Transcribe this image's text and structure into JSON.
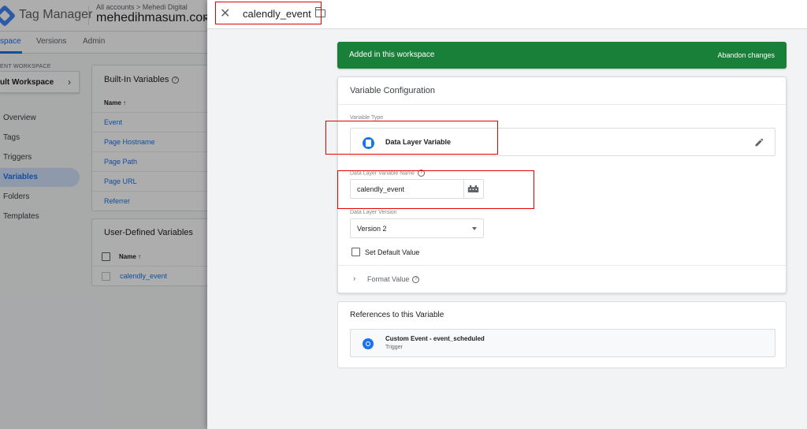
{
  "app": {
    "name": "Tag Manager",
    "breadcrumb": "All accounts > Mehedi Digital",
    "container": "mehedihmasum.com"
  },
  "tabs": [
    {
      "label": "Workspace",
      "visible_text": "space",
      "active": true
    },
    {
      "label": "Versions",
      "active": false
    },
    {
      "label": "Admin",
      "active": false
    }
  ],
  "workspace": {
    "label": "ENT WORKSPACE",
    "name": "ult Workspace"
  },
  "sidebar": {
    "items": [
      {
        "label": "Overview",
        "active": false
      },
      {
        "label": "Tags",
        "active": false
      },
      {
        "label": "Triggers",
        "active": false
      },
      {
        "label": "Variables",
        "active": true
      },
      {
        "label": "Folders",
        "active": false
      },
      {
        "label": "Templates",
        "active": false
      }
    ]
  },
  "builtin": {
    "title": "Built-In Variables",
    "column": "Name ↑",
    "rows": [
      "Event",
      "Page Hostname",
      "Page Path",
      "Page URL",
      "Referrer"
    ]
  },
  "userdefined": {
    "title": "User-Defined Variables",
    "column": "Name ↑",
    "rows": [
      "calendly_event"
    ]
  },
  "panel": {
    "title": "calendly_event",
    "banner": {
      "text": "Added in this workspace",
      "action": "Abandon changes",
      "color": "#188038"
    },
    "config": {
      "title": "Variable Configuration",
      "type_label": "Variable Type",
      "type_name": "Data Layer Variable",
      "name_label": "Data Layer Variable Name",
      "name_value": "calendly_event",
      "version_label": "Data Layer Version",
      "version_value": "Version 2",
      "default_label": "Set Default Value",
      "format_label": "Format Value"
    },
    "references": {
      "title": "References to this Variable",
      "items": [
        {
          "name": "Custom Event - event_scheduled",
          "type": "Trigger"
        }
      ]
    }
  },
  "colors": {
    "accent": "#1a73e8",
    "success": "#188038",
    "annotation": "#e50000"
  }
}
